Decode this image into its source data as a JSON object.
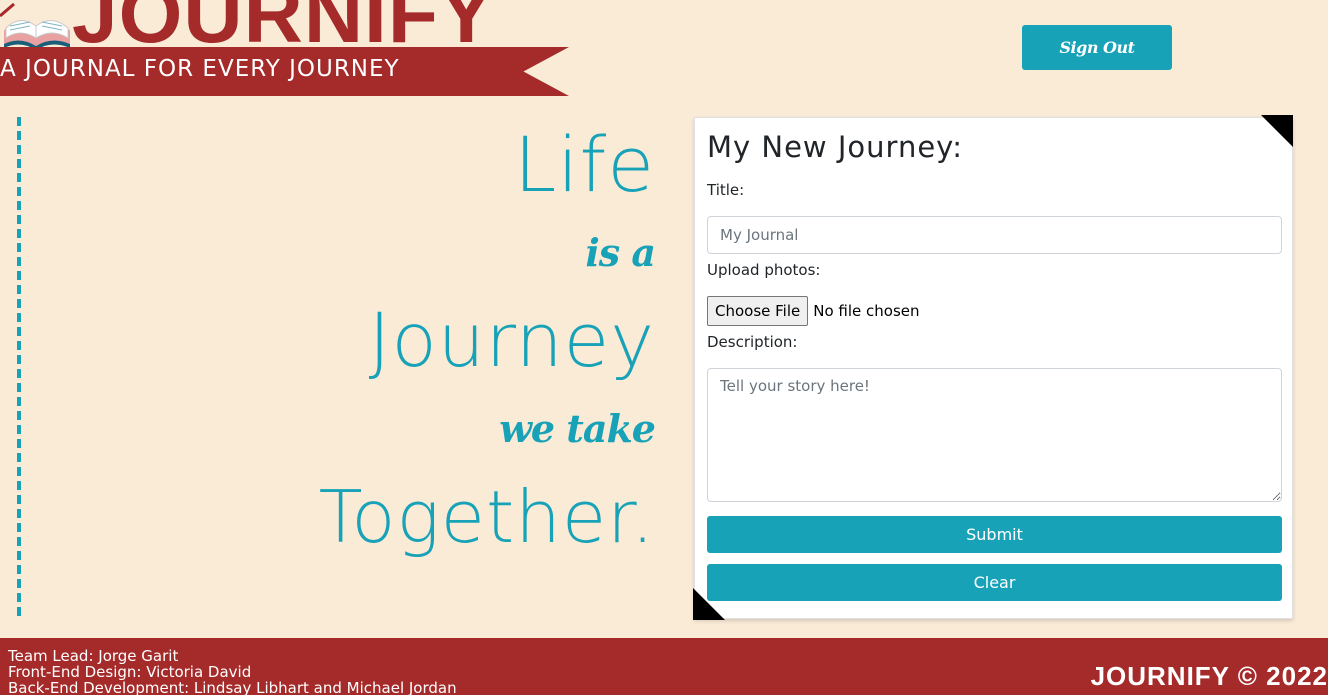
{
  "header": {
    "brand": "JOURNIFY",
    "tagline": "A JOURNAL FOR EVERY JOURNEY",
    "signout_label": "Sign Out",
    "logo_icon": "open-book-icon"
  },
  "quote": {
    "line1": "Life",
    "line2": "is a",
    "line3": "Journey",
    "line4": "we take",
    "line5": "Together."
  },
  "form": {
    "title": "My New Journey:",
    "title_label": "Title:",
    "title_placeholder": "My Journal",
    "photos_label": "Upload photos:",
    "file_button": "Choose File",
    "file_status": "No file chosen",
    "description_label": "Description:",
    "description_placeholder": "Tell your story here!",
    "submit_label": "Submit",
    "clear_label": "Clear"
  },
  "footer": {
    "credits": [
      "Team Lead: Jorge Garit",
      "Front-End Design: Victoria David",
      "Back-End Development: Lindsay Libhart and Michael Jordan"
    ],
    "copyright": "JOURNIFY © 2022"
  },
  "colors": {
    "background": "#faebd7",
    "brand_red": "#a52a2a",
    "accent_teal": "#17a2b8",
    "card": "#ffffff"
  }
}
